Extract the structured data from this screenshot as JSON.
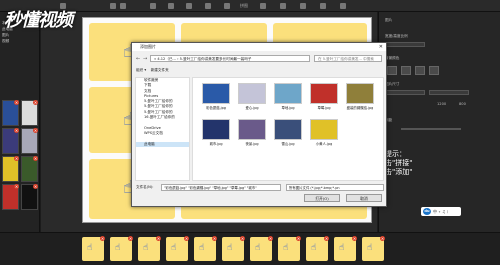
{
  "app": {
    "title": "拼图"
  },
  "watermark": {
    "text": "秒懂视频"
  },
  "left_tree": [
    "本机",
    "此电脑",
    "图片",
    "视频"
  ],
  "dialog": {
    "title": "添加图片",
    "close": "✕",
    "address": "« 4.12（已... › 5.曼叶工厂给你讲美发要多长时间最一装吗子",
    "search_placeholder": "在 5.曼叶工厂给你讲美发... 中搜索",
    "toolbar": {
      "organize": "组织 ▾",
      "new_folder": "新建文件夹"
    },
    "nav_items": [
      "软件廠房",
      "下载",
      "文档",
      "Pictures",
      "5.曼叶工厂给你的",
      "5.曼叶工厂给你的",
      "5.曼叶工厂给你的",
      "16.曼叶工厂给你的",
      "",
      "OneDrive",
      "WPS云文档",
      "",
      "此电脑"
    ],
    "nav_selected": 12,
    "files": [
      {
        "name": "彩色蘑菇.jpg",
        "color": "#2a5aa8"
      },
      {
        "name": "爱心.jpg",
        "color": "#c4c4d8"
      },
      {
        "name": "草地.jpg",
        "color": "#6ea6c9"
      },
      {
        "name": "草莓.jpg",
        "color": "#c0302a"
      },
      {
        "name": "盛装的蝴蝶结.jpg",
        "color": "#8f7f3a"
      },
      {
        "name": "城市.jpg",
        "color": "#23346b"
      },
      {
        "name": "夜景.jpg",
        "color": "#6a5a8a"
      },
      {
        "name": "雪山.jpg",
        "color": "#3a4f7a"
      },
      {
        "name": "小黄人.jpg",
        "color": "#e0c128"
      }
    ],
    "filename_label": "文件名(N):",
    "filename_value": "\"彩色蘑菇.jpg\" \"彩色蝴蝶.jpg\" \"草地.jpg\" \"草莓.jpg\" \"城市\"",
    "filetype_value": "所有图片文件 (*.jpg;*.bmp;*.pn",
    "open_button": "打开(O)",
    "cancel_button": "取消"
  },
  "hint": {
    "line1": "小提示：",
    "line2": "点击\"拼接\"",
    "line3": "点击\"添加\""
  },
  "right_panel": {
    "label1": "图片",
    "label2": "宽度/高度比例",
    "label3": "背景颜色",
    "label4": "图片尺寸",
    "label5": "间距",
    "value_w": "1200",
    "value_h": "800"
  },
  "lang_bar": {
    "text": "中 ∘ ♫ ⁝"
  },
  "colors": {
    "cell": "#fbe07c",
    "hand": "#1f4fd6",
    "accent": "#d9402a"
  }
}
